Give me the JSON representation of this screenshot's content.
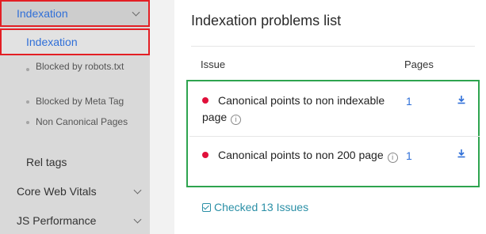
{
  "sidebar": {
    "section_label": "Indexation",
    "active_sub_label": "Indexation",
    "sub_items": [
      {
        "label": "Blocked by robots.txt"
      },
      {
        "label": "Blocked by Meta Tag"
      },
      {
        "label": "Non Canonical Pages"
      }
    ],
    "rel_tags_label": "Rel tags",
    "core_web_vitals_label": "Core Web Vitals",
    "js_performance_label": "JS Performance"
  },
  "panel": {
    "title": "Indexation problems list",
    "col_issue": "Issue",
    "col_pages": "Pages",
    "rows": [
      {
        "issue": "Canonical points to non indexable page",
        "pages": "1"
      },
      {
        "issue": "Canonical points to non 200 page",
        "pages": "1"
      }
    ],
    "checked_label": "Checked 13 Issues"
  },
  "colors": {
    "accent_blue": "#2f6fd8",
    "highlight_red": "#e31e24",
    "highlight_green": "#2ea44f",
    "bullet_red": "#e0103a",
    "checked_teal": "#2a8fa6"
  },
  "icons": {
    "chevron": "chevron-down-icon",
    "info": "info-icon",
    "download": "download-icon",
    "checkbox": "checkbox-checked-icon"
  }
}
